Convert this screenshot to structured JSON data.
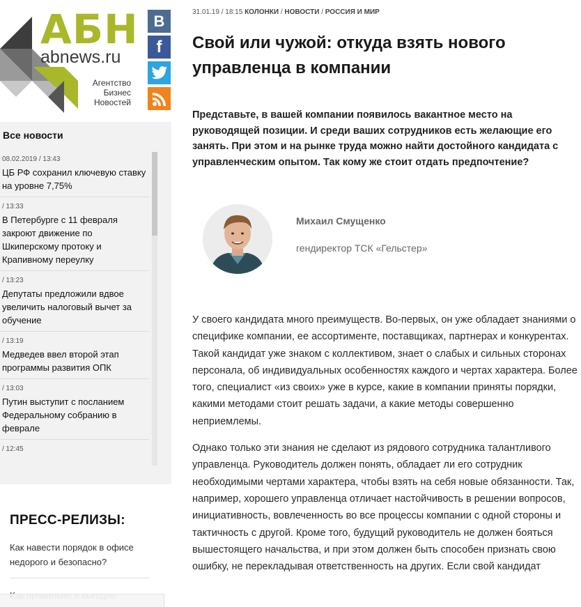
{
  "logo": {
    "letters": "АБН",
    "domain": "abnews.ru",
    "tagline": [
      "Агентство",
      "Бизнес",
      "Новостей"
    ]
  },
  "social": [
    {
      "name": "vk",
      "glyph": "В",
      "color": "#4c6c91"
    },
    {
      "name": "facebook",
      "glyph": "f",
      "color": "#3b5998"
    },
    {
      "name": "twitter",
      "color": "#2ea4e0"
    },
    {
      "name": "rss",
      "color": "#f0831b"
    }
  ],
  "news": {
    "heading": "Все новости",
    "items": [
      {
        "time": "08.02.2019 / 13:43",
        "title": "ЦБ РФ сохранил ключевую ставку на уровне 7,75%"
      },
      {
        "time": "/ 13:33",
        "title": "В Петербурге с 11 февраля закроют движение по Шкиперскому протоку и Крапивному переулку"
      },
      {
        "time": "/ 13:23",
        "title": "Депутаты предложили вдвое увеличить налоговый вычет за обучение"
      },
      {
        "time": "/ 13:19",
        "title": "Медведев ввел второй этап программы развития ОПК"
      },
      {
        "time": "/ 13:03",
        "title": "Путин выступит с посланием Федеральному собранию в феврале"
      },
      {
        "time": "/ 12:45",
        "title": ""
      }
    ]
  },
  "press": {
    "heading": "ПРЕСС-РЕЛИЗЫ:",
    "items": [
      "Как навести порядок в офисе недорого и безопасно?",
      "Как правильно и выгодно"
    ]
  },
  "article": {
    "date": "31.01.19 / 18:15",
    "categories": [
      "КОЛОНКИ",
      "НОВОСТИ",
      "РОССИЯ И МИР"
    ],
    "title": "Свой или чужой: откуда взять нового управленца в компании",
    "lead": "Представьте, в вашей компании появилось вакантное место на руководящей позиции. И среди ваших сотрудников есть желающие его занять. При этом и на рынке труда можно найти достойного кандидата с управленческим опытом. Так кому же стоит отдать предпочтение?",
    "author": {
      "name": "Михаил Смущенко",
      "role": "гендиректор ТСК «Гельстер»"
    },
    "paragraphs": [
      "У своего кандидата много преимуществ. Во-первых, он уже обладает знаниями о специфике компании, ее ассортименте, поставщиках, партнерах и конкурентах. Такой кандидат уже знаком с коллективом, знает о слабых и сильных сторонах персонала, об индивидуальных особенностях каждого и чертах характера. Более того, специалист «из своих» уже в курсе, какие в компании приняты порядки, какими методами стоит решать задачи, а какие методы совершенно неприемлемы.",
      "Однако только эти знания не сделают из рядового сотрудника талантливого управленца. Руководитель должен понять, обладает ли его сотрудник необходимыми чертами характера, чтобы взять на себя новые обязанности. Так, например, хорошего управленца отличает настойчивость в решении вопросов, инициативность, вовлеченность во все процессы компании с одной стороны и тактичность с другой. Кроме того, будущий руководитель не должен бояться вышестоящего начальства, и при этом должен быть способен признать свою ошибку, не перекладывая ответственность на других. Если свой кандидат"
    ]
  }
}
